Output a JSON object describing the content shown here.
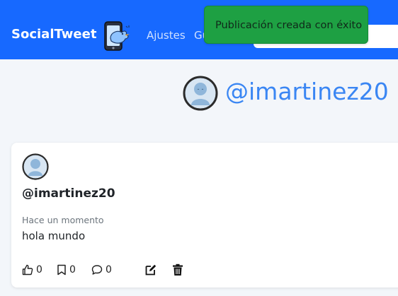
{
  "navbar": {
    "brand": "SocialTweet",
    "links": [
      {
        "label": "Ajustes"
      },
      {
        "label": "Gu"
      }
    ],
    "search_placeholder": ""
  },
  "toast": {
    "message": "Publicación creada con éxito"
  },
  "profile": {
    "handle": "@imartinez20"
  },
  "post": {
    "handle": "@imartinez20",
    "time": "Hace un momento",
    "text": "hola mundo",
    "likes": "0",
    "saves": "0",
    "comments": "0"
  },
  "icons": {
    "logo": "phone-bird-logo",
    "like": "thumbs-up-icon",
    "save": "bookmark-icon",
    "comment": "comment-icon",
    "edit": "edit-icon",
    "delete": "trash-icon"
  },
  "colors": {
    "navbar": "#1769ff",
    "toast": "#1ea043",
    "handle": "#3a86f3"
  }
}
